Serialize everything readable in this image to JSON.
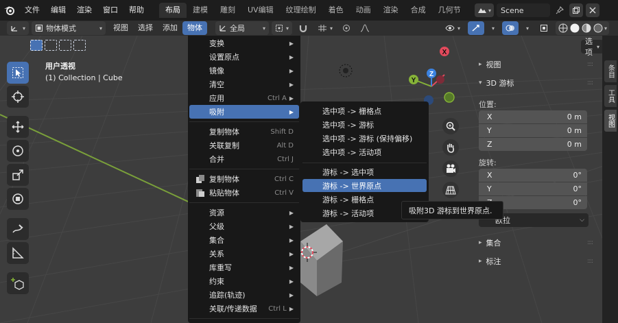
{
  "topbar": {
    "menus": [
      "文件",
      "编辑",
      "渲染",
      "窗口",
      "帮助"
    ],
    "tabs": [
      "布局",
      "建模",
      "雕刻",
      "UV编辑",
      "纹理绘制",
      "着色",
      "动画",
      "渲染",
      "合成",
      "几何节"
    ],
    "active_tab": "布局",
    "scene_name": "Scene"
  },
  "viewport_header": {
    "mode": "物体模式",
    "menus": [
      "视图",
      "选择",
      "添加",
      "物体"
    ],
    "active_menu": "物体",
    "transform_orientation": "全局"
  },
  "viewport": {
    "title": "用户透视",
    "subtitle": "(1) Collection | Cube",
    "options_label": "选项"
  },
  "object_menu": {
    "items": [
      {
        "label": "变换",
        "submenu": true
      },
      {
        "label": "设置原点",
        "submenu": true
      },
      {
        "label": "镜像",
        "submenu": true
      },
      {
        "label": "清空",
        "submenu": true
      },
      {
        "label": "应用",
        "shortcut": "Ctrl A",
        "submenu": true
      },
      {
        "label": "吸附",
        "submenu": true,
        "highlighted": true
      },
      {
        "label": "复制物体",
        "shortcut": "Shift D"
      },
      {
        "label": "关联复制",
        "shortcut": "Alt D"
      },
      {
        "label": "合并",
        "shortcut": "Ctrl J"
      },
      {
        "label": "复制物体",
        "shortcut": "Ctrl C",
        "icon": "copy-icon"
      },
      {
        "label": "粘贴物体",
        "shortcut": "Ctrl V",
        "icon": "paste-icon"
      },
      {
        "label": "资源",
        "submenu": true
      },
      {
        "label": "父级",
        "submenu": true
      },
      {
        "label": "集合",
        "submenu": true
      },
      {
        "label": "关系",
        "submenu": true
      },
      {
        "label": "库重写",
        "submenu": true
      },
      {
        "label": "约束",
        "submenu": true
      },
      {
        "label": "追踪(轨迹)",
        "submenu": true
      },
      {
        "label": "关联/传递数据",
        "shortcut": "Ctrl L",
        "submenu": true
      }
    ]
  },
  "snap_menu": {
    "items": [
      {
        "label": "选中项 -> 栅格点"
      },
      {
        "label": "选中项 -> 游标"
      },
      {
        "label": "选中项 -> 游标 (保持偏移)"
      },
      {
        "label": "选中项 -> 活动项"
      },
      {
        "label": "游标 -> 选中项"
      },
      {
        "label": "游标 -> 世界原点",
        "highlighted": true
      },
      {
        "label": "游标 -> 栅格点"
      },
      {
        "label": "游标 -> 活动项"
      }
    ]
  },
  "tooltip": "吸附3D 游标到世界原点.",
  "sidebar": {
    "sections": {
      "view": "视图",
      "cursor3d": "3D 游标",
      "collection": "集合",
      "annotation": "标注"
    },
    "location_label": "位置:",
    "location": [
      {
        "axis": "X",
        "value": "0 m"
      },
      {
        "axis": "Y",
        "value": "0 m"
      },
      {
        "axis": "Z",
        "value": "0 m"
      }
    ],
    "rotation_label": "旋转:",
    "rotation": [
      {
        "axis": "X",
        "value": "0°"
      },
      {
        "axis": "Y",
        "value": "0°"
      },
      {
        "axis": "Z",
        "value": "0°"
      }
    ],
    "rotation_mode": "欧拉",
    "tabs": [
      "条目",
      "工具",
      "视图"
    ],
    "active_tab": "视图"
  },
  "gizmo": {
    "x": "X",
    "y": "Y",
    "z": "Z"
  },
  "colors": {
    "accent": "#4772b3",
    "axis_x": "#e34a5c",
    "axis_y": "#86b338",
    "axis_z": "#3b82e0"
  }
}
